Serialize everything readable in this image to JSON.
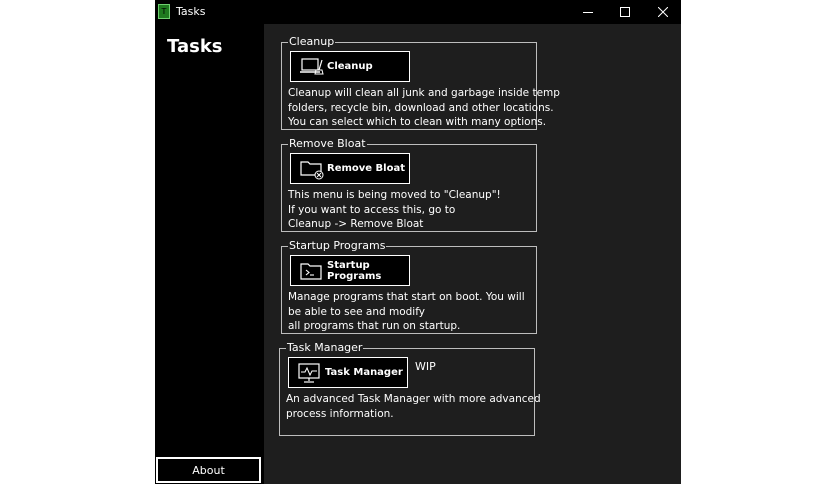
{
  "window": {
    "title": "Tasks",
    "app_icon_glyph": "T"
  },
  "sidebar": {
    "title": "Tasks",
    "about_label": "About"
  },
  "groups": [
    {
      "title": "Cleanup",
      "button_label": "Cleanup",
      "icon": "laptop-broom-icon",
      "description": [
        "Cleanup will clean all junk and garbage inside temp",
        "folders, recycle bin, download and other locations.",
        "You can select which to clean with many options."
      ]
    },
    {
      "title": "Remove Bloat",
      "button_label": "Remove Bloat",
      "icon": "folder-remove-icon",
      "description": [
        "This menu is being moved to \"Cleanup\"!",
        "If you want to access this, go to",
        "Cleanup -> Remove Bloat"
      ]
    },
    {
      "title": "Startup Programs",
      "button_label": "Startup Programs",
      "icon": "folder-terminal-icon",
      "description": [
        "Manage programs that start on boot. You will",
        "be able to see and modify",
        "all programs that run on startup."
      ]
    },
    {
      "title": "Task Manager",
      "button_label": "Task Manager",
      "icon": "monitor-activity-icon",
      "wip": "WIP",
      "description": [
        "An advanced Task Manager with more advanced",
        "process information."
      ]
    }
  ],
  "colors": {
    "content_bg": "#1e1e1e",
    "sidebar_bg": "#000000",
    "text": "#ffffff",
    "border": "#bdbdbd"
  }
}
